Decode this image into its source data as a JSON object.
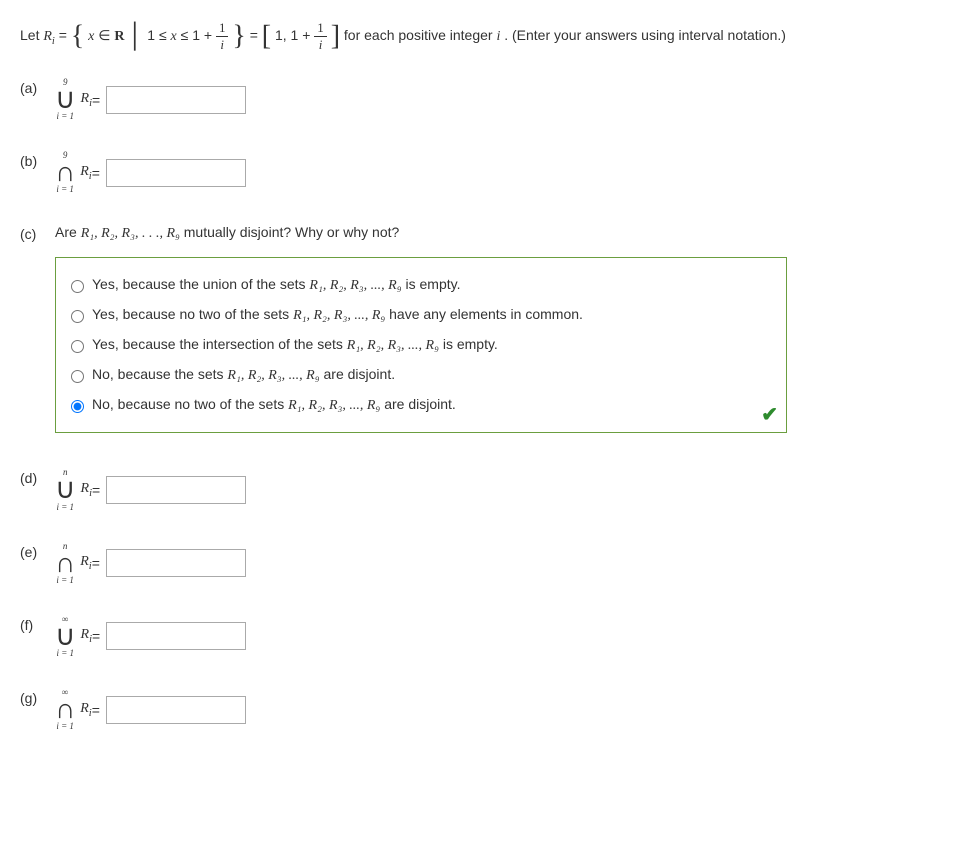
{
  "intro": {
    "let": "Let ",
    "R": "R",
    "sub_i": "i",
    "equals": " = ",
    "set_x": "x",
    "in": " ∈ ",
    "real": "R",
    "cond_left": "1 ≤ ",
    "cond_mid": " ≤ 1 + ",
    "frac_num1": "1",
    "frac_den1": "i",
    "equals2": " = ",
    "interval_1": "1, 1 + ",
    "frac_num2": "1",
    "frac_den2": "i",
    "tail": " for each positive integer ",
    "i": "i",
    "tail2": ". (Enter your answers using interval notation.)"
  },
  "parts": {
    "a": {
      "label": "(a)",
      "upper": "9",
      "symbol": "∪",
      "lower": "i = 1",
      "R": "R",
      "sub": "i",
      "eq": " ="
    },
    "b": {
      "label": "(b)",
      "upper": "9",
      "symbol": "∩",
      "lower": "i = 1",
      "R": "R",
      "sub": "i",
      "eq": " ="
    },
    "d": {
      "label": "(d)",
      "upper": "n",
      "symbol": "∪",
      "lower": "i = 1",
      "R": "R",
      "sub": "i",
      "eq": " ="
    },
    "e": {
      "label": "(e)",
      "upper": "n",
      "symbol": "∩",
      "lower": "i = 1",
      "R": "R",
      "sub": "i",
      "eq": " ="
    },
    "f": {
      "label": "(f)",
      "upper": "∞",
      "symbol": "∪",
      "lower": "i = 1",
      "R": "R",
      "sub": "i",
      "eq": " ="
    },
    "g": {
      "label": "(g)",
      "upper": "∞",
      "symbol": "∩",
      "lower": "i = 1",
      "R": "R",
      "sub": "i",
      "eq": " ="
    }
  },
  "partC": {
    "label": "(c)",
    "question_pre": "Are ",
    "question_sets": "R₁, R₂, R₃, . . ., R₉",
    "question_post": " mutually disjoint? Why or why not?",
    "options": [
      {
        "pre": "Yes, because the union of the sets ",
        "sets": "R₁, R₂, R₃, ..., R₉",
        "post": " is empty."
      },
      {
        "pre": "Yes, because no two of the sets ",
        "sets": "R₁, R₂, R₃, ..., R₉",
        "post": " have any elements in common."
      },
      {
        "pre": "Yes, because the intersection of the sets ",
        "sets": "R₁, R₂, R₃, ..., R₉",
        "post": " is empty."
      },
      {
        "pre": "No, because the sets ",
        "sets": "R₁, R₂, R₃, ..., R₉",
        "post": " are disjoint."
      },
      {
        "pre": "No, because no two of the sets ",
        "sets": "R₁, R₂, R₃, ..., R₉",
        "post": " are disjoint."
      }
    ],
    "selected": 4
  }
}
